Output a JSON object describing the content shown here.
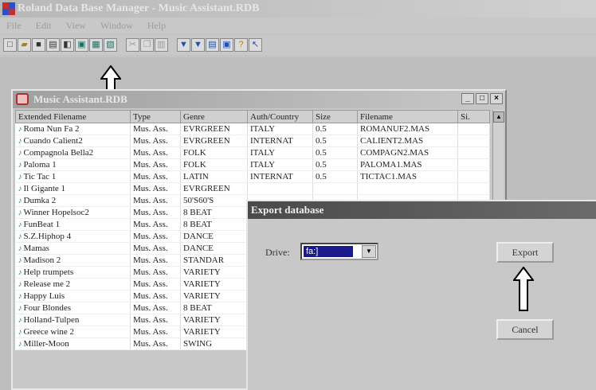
{
  "app": {
    "title": "Roland Data Base Manager - Music Assistant.RDB",
    "menu": [
      "File",
      "Edit",
      "View",
      "Window",
      "Help"
    ]
  },
  "toolbar": {
    "icons": [
      "new-file-icon",
      "open-folder-icon",
      "save-icon",
      "print-icon",
      "disk-icon",
      "import-icon",
      "export-icon",
      "convert-icon",
      "cut-icon",
      "copy-icon",
      "paste-icon",
      "filter-icon",
      "filter-alt-icon",
      "table-icon",
      "monitor-icon",
      "help-icon",
      "help-arrow-icon"
    ]
  },
  "document": {
    "title": "Music Assistant.RDB",
    "win_buttons": [
      "_",
      "□",
      "×"
    ],
    "columns": [
      "Extended Filename",
      "Type",
      "Genre",
      "Auth/Country",
      "Size",
      "Filename",
      "Si."
    ],
    "rows": [
      [
        "Roma Nun Fa 2",
        "Mus. Ass.",
        "EVRGREEN",
        "ITALY",
        "0.5",
        "ROMANUF2.MAS"
      ],
      [
        "Cuando Calient2",
        "Mus. Ass.",
        "EVRGREEN",
        "INTERNAT",
        "0.5",
        "CALIENT2.MAS"
      ],
      [
        "Compagnola Bella2",
        "Mus. Ass.",
        "FOLK",
        "ITALY",
        "0.5",
        "COMPAGN2.MAS"
      ],
      [
        "Paloma 1",
        "Mus. Ass.",
        "FOLK",
        "ITALY",
        "0.5",
        "PALOMA1.MAS"
      ],
      [
        "Tic Tac 1",
        "Mus. Ass.",
        "LATIN",
        "INTERNAT",
        "0.5",
        "TICTAC1.MAS"
      ],
      [
        "Il Gigante 1",
        "Mus. Ass.",
        "EVRGREEN",
        "",
        "",
        ""
      ],
      [
        "Dumka 2",
        "Mus. Ass.",
        "50'S60'S",
        "",
        "",
        ""
      ],
      [
        "Winner Hopelsoc2",
        "Mus. Ass.",
        "8 BEAT",
        "",
        "",
        ""
      ],
      [
        "FunBeat 1",
        "Mus. Ass.",
        "8 BEAT",
        "",
        "",
        ""
      ],
      [
        "S.Z.Hiphop 4",
        "Mus. Ass.",
        "DANCE",
        "",
        "",
        ""
      ],
      [
        "Mamas",
        "Mus. Ass.",
        "DANCE",
        "",
        "",
        ""
      ],
      [
        "Madison 2",
        "Mus. Ass.",
        "STANDAR",
        "",
        "",
        ""
      ],
      [
        "Help trumpets",
        "Mus. Ass.",
        "VARIETY",
        "",
        "",
        ""
      ],
      [
        "Release me 2",
        "Mus. Ass.",
        "VARIETY",
        "",
        "",
        ""
      ],
      [
        "Happy Luis",
        "Mus. Ass.",
        "VARIETY",
        "",
        "",
        ""
      ],
      [
        "Four Blondes",
        "Mus. Ass.",
        "8 BEAT",
        "",
        "",
        ""
      ],
      [
        "Holland-Tulpen",
        "Mus. Ass.",
        "VARIETY",
        "",
        "",
        ""
      ],
      [
        "Greece wine 2",
        "Mus. Ass.",
        "VARIETY",
        "",
        "",
        ""
      ],
      [
        "Miller-Moon",
        "Mus. Ass.",
        "SWING",
        "",
        "",
        ""
      ]
    ]
  },
  "dialog": {
    "title": "Export database",
    "drive_label": "Drive:",
    "drive_value": "fa:]",
    "export_label": "Export",
    "cancel_label": "Cancel"
  }
}
